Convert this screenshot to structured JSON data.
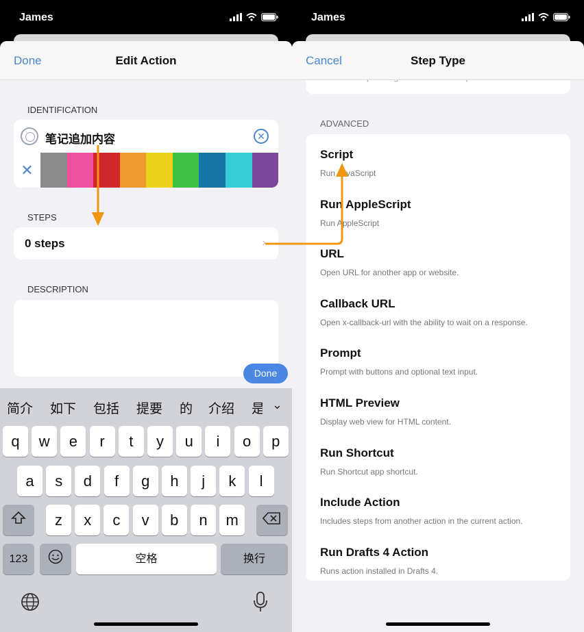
{
  "status": {
    "owner": "James"
  },
  "left": {
    "nav": {
      "left_label": "Done",
      "title": "Edit Action"
    },
    "identification": {
      "section_label": "IDENTIFICATION",
      "name_value": "笔记追加内容",
      "swatches": [
        "#8a8a8a",
        "#f04fa0",
        "#d3272e",
        "#ec9a2c",
        "#ecd21c",
        "#3cc240",
        "#1675a8",
        "#36cdd6",
        "#7a479a"
      ]
    },
    "steps": {
      "section_label": "STEPS",
      "count_label": "0 steps"
    },
    "description": {
      "section_label": "DESCRIPTION"
    },
    "keyboard_done": "Done",
    "keyboard": {
      "candidates": [
        "简介",
        "如下",
        "包括",
        "提要",
        "的",
        "介绍",
        "是"
      ],
      "row1": [
        "q",
        "w",
        "e",
        "r",
        "t",
        "y",
        "u",
        "i",
        "o",
        "p"
      ],
      "row2": [
        "a",
        "s",
        "d",
        "f",
        "g",
        "h",
        "j",
        "k",
        "l"
      ],
      "row3": [
        "z",
        "x",
        "c",
        "v",
        "b",
        "n",
        "m"
      ],
      "numbers_key": "123",
      "space_key": "空格",
      "return_key": "换行"
    }
  },
  "right": {
    "nav": {
      "left_label": "Cancel",
      "title": "Step Type"
    },
    "partial_text": "Define a template tag for use in later steps.",
    "advanced_label": "ADVANCED",
    "items": [
      {
        "title": "Script",
        "subtitle": "Run JavaScript"
      },
      {
        "title": "Run AppleScript",
        "subtitle": "Run AppleScript"
      },
      {
        "title": "URL",
        "subtitle": "Open URL for another app or website."
      },
      {
        "title": "Callback URL",
        "subtitle": "Open x-callback-url with the ability to wait on a response."
      },
      {
        "title": "Prompt",
        "subtitle": "Prompt with buttons and optional text input."
      },
      {
        "title": "HTML Preview",
        "subtitle": "Display web view for HTML content."
      },
      {
        "title": "Run Shortcut",
        "subtitle": "Run Shortcut app shortcut."
      },
      {
        "title": "Include Action",
        "subtitle": "Includes steps from another action in the current action."
      },
      {
        "title": "Run Drafts 4 Action",
        "subtitle": "Runs action installed in Drafts 4."
      }
    ]
  },
  "colors": {
    "accent": "#4a86c9",
    "annotation_arrow": "#f0950f"
  }
}
